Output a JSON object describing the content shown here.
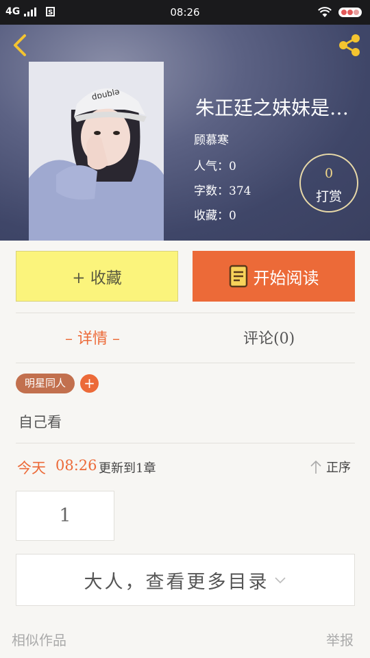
{
  "status_bar": {
    "network": "4G",
    "time": "08:26"
  },
  "book": {
    "title": "朱正廷之妹妹是…",
    "author": "顾慕寒",
    "popularity": "人气：0",
    "word_count": "字数：374",
    "favorites": "收藏：0",
    "reward_count": "0",
    "reward_label": "打赏"
  },
  "actions": {
    "collect_label": "+ 收藏",
    "read_label": "开始阅读"
  },
  "tabs": {
    "detail": "– 详情 –",
    "comments": "评论(0)"
  },
  "detail": {
    "tag": "明星同人",
    "tag_add": "+",
    "description": "自己看"
  },
  "update": {
    "day": "今天",
    "time": "08:26",
    "text": "更新到1章",
    "order_label": "正序"
  },
  "chapters": [
    "1"
  ],
  "more_catalog": "大人，查看更多目录",
  "footer": {
    "similar": "相似作品",
    "report": "举报"
  },
  "colors": {
    "accent": "#ec6a38",
    "collect_bg": "#fbf47c",
    "tag_bg": "#c2704e",
    "icon_yellow": "#f4c430"
  }
}
